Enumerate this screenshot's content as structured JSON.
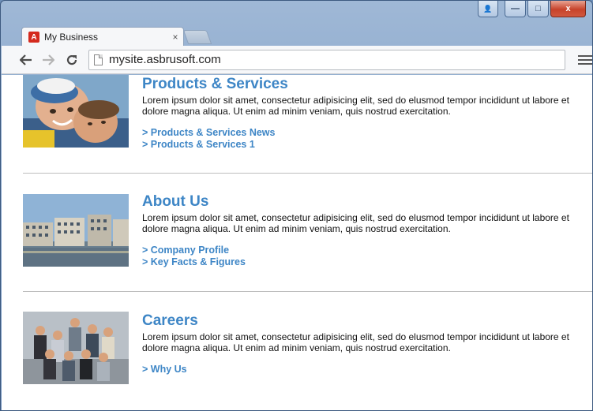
{
  "browser": {
    "tab_title": "My Business",
    "tab_close": "×",
    "url": "mysite.asbrusoft.com",
    "favicon_letter": "A"
  },
  "window_controls": {
    "user": "👤",
    "minimize": "—",
    "maximize": "□",
    "close": "x"
  },
  "sections": [
    {
      "title": "Products & Services",
      "description": "Lorem ipsum dolor sit amet, consectetur adipisicing elit, sed do elusmod tempor incididunt ut labore et dolore magna aliqua. Ut enim ad minim veniam, quis nostrud exercitation.",
      "links": [
        "> Products & Services News",
        "> Products & Services 1"
      ]
    },
    {
      "title": "About Us",
      "description": "Lorem ipsum dolor sit amet, consectetur adipisicing elit, sed do elusmod tempor incididunt ut labore et dolore magna aliqua. Ut enim ad minim veniam, quis nostrud exercitation.",
      "links": [
        "> Company Profile",
        "> Key Facts & Figures"
      ]
    },
    {
      "title": "Careers",
      "description": "Lorem ipsum dolor sit amet, consectetur adipisicing elit, sed do elusmod tempor incididunt ut labore et dolore magna aliqua. Ut enim ad minim veniam, quis nostrud exercitation.",
      "links": [
        "> Why Us"
      ]
    }
  ],
  "colors": {
    "link_blue": "#3e86c6",
    "window_frame": "#7d9cc4",
    "close_red": "#c7432b"
  }
}
